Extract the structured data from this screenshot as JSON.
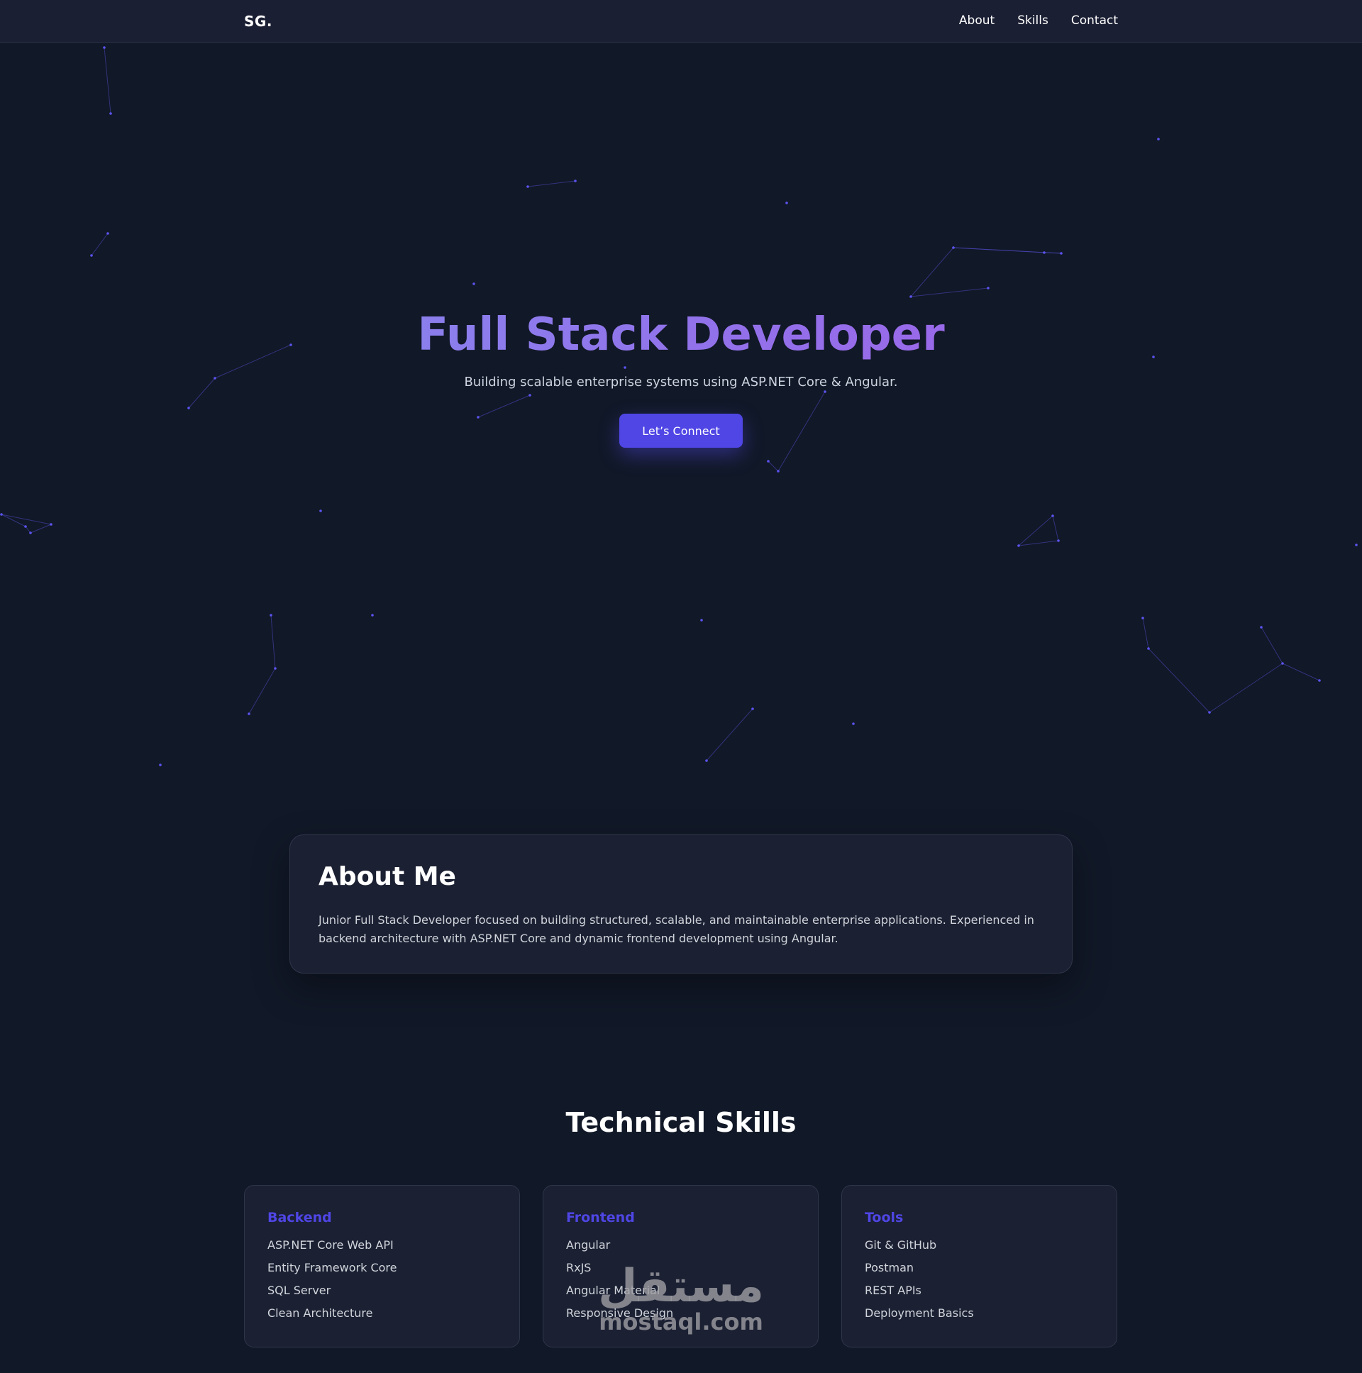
{
  "nav": {
    "logo": "SG.",
    "links": [
      {
        "label": "About"
      },
      {
        "label": "Skills"
      },
      {
        "label": "Contact"
      }
    ]
  },
  "hero": {
    "title": "Full Stack Developer",
    "subtitle": "Building scalable enterprise systems using ASP.NET Core & Angular.",
    "cta_label": "Let’s Connect"
  },
  "about": {
    "title": "About Me",
    "text": "Junior Full Stack Developer focused on building structured, scalable, and maintainable enterprise applications. Experienced in backend architecture with ASP.NET Core and dynamic frontend development using Angular."
  },
  "skills": {
    "title": "Technical Skills",
    "cards": [
      {
        "title": "Backend",
        "items": [
          "ASP.NET Core Web API",
          "Entity Framework Core",
          "SQL Server",
          "Clean Architecture"
        ]
      },
      {
        "title": "Frontend",
        "items": [
          "Angular",
          "RxJS",
          "Angular Material",
          "Responsive Design"
        ]
      },
      {
        "title": "Tools",
        "items": [
          "Git & GitHub",
          "Postman",
          "REST APIs",
          "Deployment Basics"
        ]
      }
    ]
  },
  "watermark": {
    "arabic": "مستقل",
    "latin": "mostaql.com"
  },
  "colors": {
    "background": "#111827",
    "surface": "#1b2033",
    "accent": "#4f46e5",
    "title_gradient_start": "#8092f0",
    "title_gradient_end": "#a45be6"
  }
}
